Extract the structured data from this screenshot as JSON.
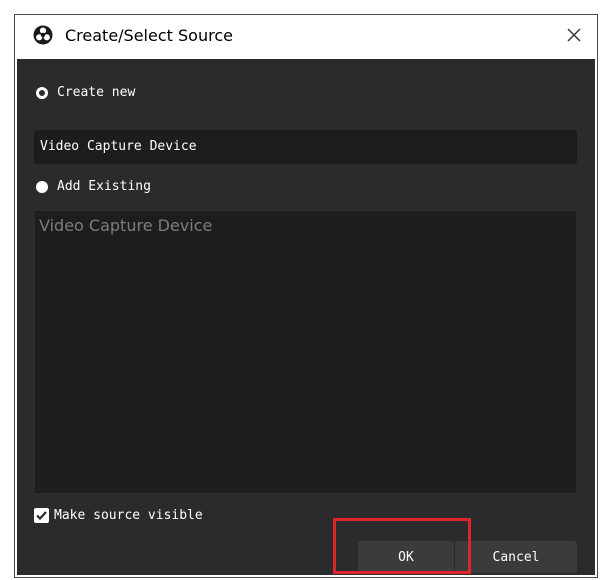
{
  "dialog": {
    "title": "Create/Select Source",
    "app_icon": "obs-logo-icon",
    "close_icon": "close-icon"
  },
  "create_new": {
    "label": "Create new",
    "selected": true,
    "value": "Video Capture Device"
  },
  "add_existing": {
    "label": "Add Existing",
    "selected": false,
    "items": [
      "Video Capture Device"
    ]
  },
  "make_visible": {
    "label": "Make source visible",
    "checked": true
  },
  "buttons": {
    "ok_label": "OK",
    "cancel_label": "Cancel"
  },
  "colors": {
    "dialog_bg": "#2b2b2d",
    "field_bg": "#1d1d1f",
    "button_bg": "#3b3b3e",
    "highlight": "#e0242c"
  }
}
